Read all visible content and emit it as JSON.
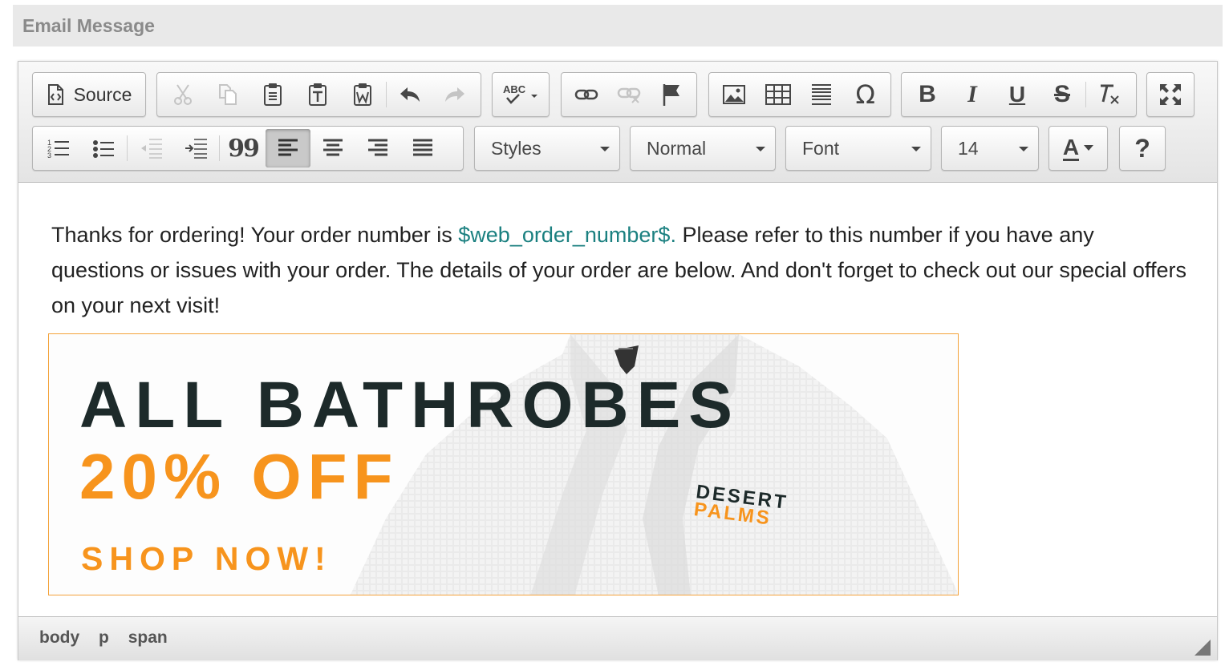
{
  "section": {
    "title": "Email Message"
  },
  "toolbar": {
    "source_label": "Source",
    "styles_value": "Styles",
    "format_value": "Normal",
    "font_value": "Font",
    "size_value": "14",
    "text_color_glyph": "A",
    "help_glyph": "?",
    "bold_glyph": "B",
    "italic_glyph": "I",
    "underline_glyph": "U",
    "strike_glyph": "S",
    "omega_glyph": "Ω",
    "quote_glyph": "99",
    "spell_glyph": "ABC",
    "active_alignment": "align-left"
  },
  "content": {
    "text_before": "Thanks for ordering! Your order number is ",
    "order_variable": "$web_order_number$.",
    "text_after": " Please refer to this number if you have any questions or issues with your order. The details of your order are below. And don't forget to check out our special offers on your next visit!",
    "banner": {
      "line1": "ALL BATHROBES",
      "line2": "20% OFF",
      "line3": "SHOP NOW!",
      "logo_line1": "DESERT",
      "logo_line2": "PALMS"
    }
  },
  "status": {
    "path": [
      "body",
      "p",
      "span"
    ]
  },
  "colors": {
    "accent_orange": "#f7941d",
    "variable_teal": "#1b8080",
    "dark_text": "#1d2a2a"
  }
}
